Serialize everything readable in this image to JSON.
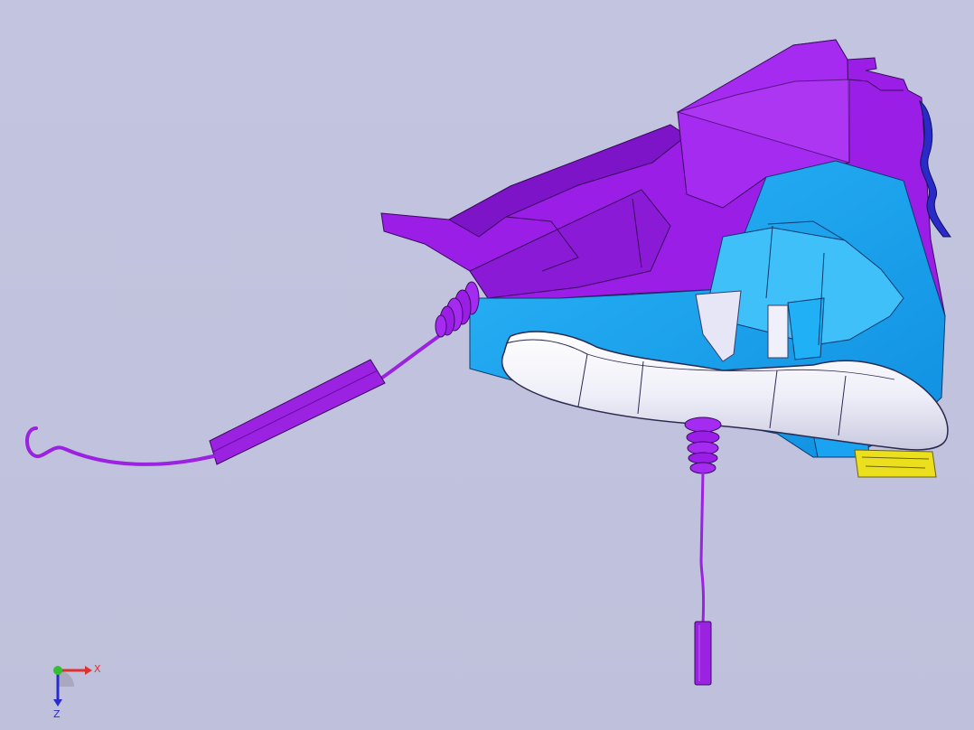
{
  "viewport": {
    "background": "#c1c3de",
    "model": {
      "parts": [
        {
          "name": "housing-upper",
          "color": "#9a1ee6"
        },
        {
          "name": "carrier-frame",
          "color": "#1aa3f0"
        },
        {
          "name": "door-handle",
          "color": "#f2f2fa"
        },
        {
          "name": "cable-left",
          "color": "#9a22e0"
        },
        {
          "name": "cable-bottom",
          "color": "#9a22e0"
        },
        {
          "name": "seal-strip",
          "color": "#2a2ac8"
        },
        {
          "name": "clip-yellow",
          "color": "#ece01e"
        }
      ]
    }
  },
  "triad": {
    "x_label": "X",
    "z_label": "Z",
    "x_color": "#e03030",
    "y_color": "#30c030",
    "z_color": "#2a2ad0"
  }
}
